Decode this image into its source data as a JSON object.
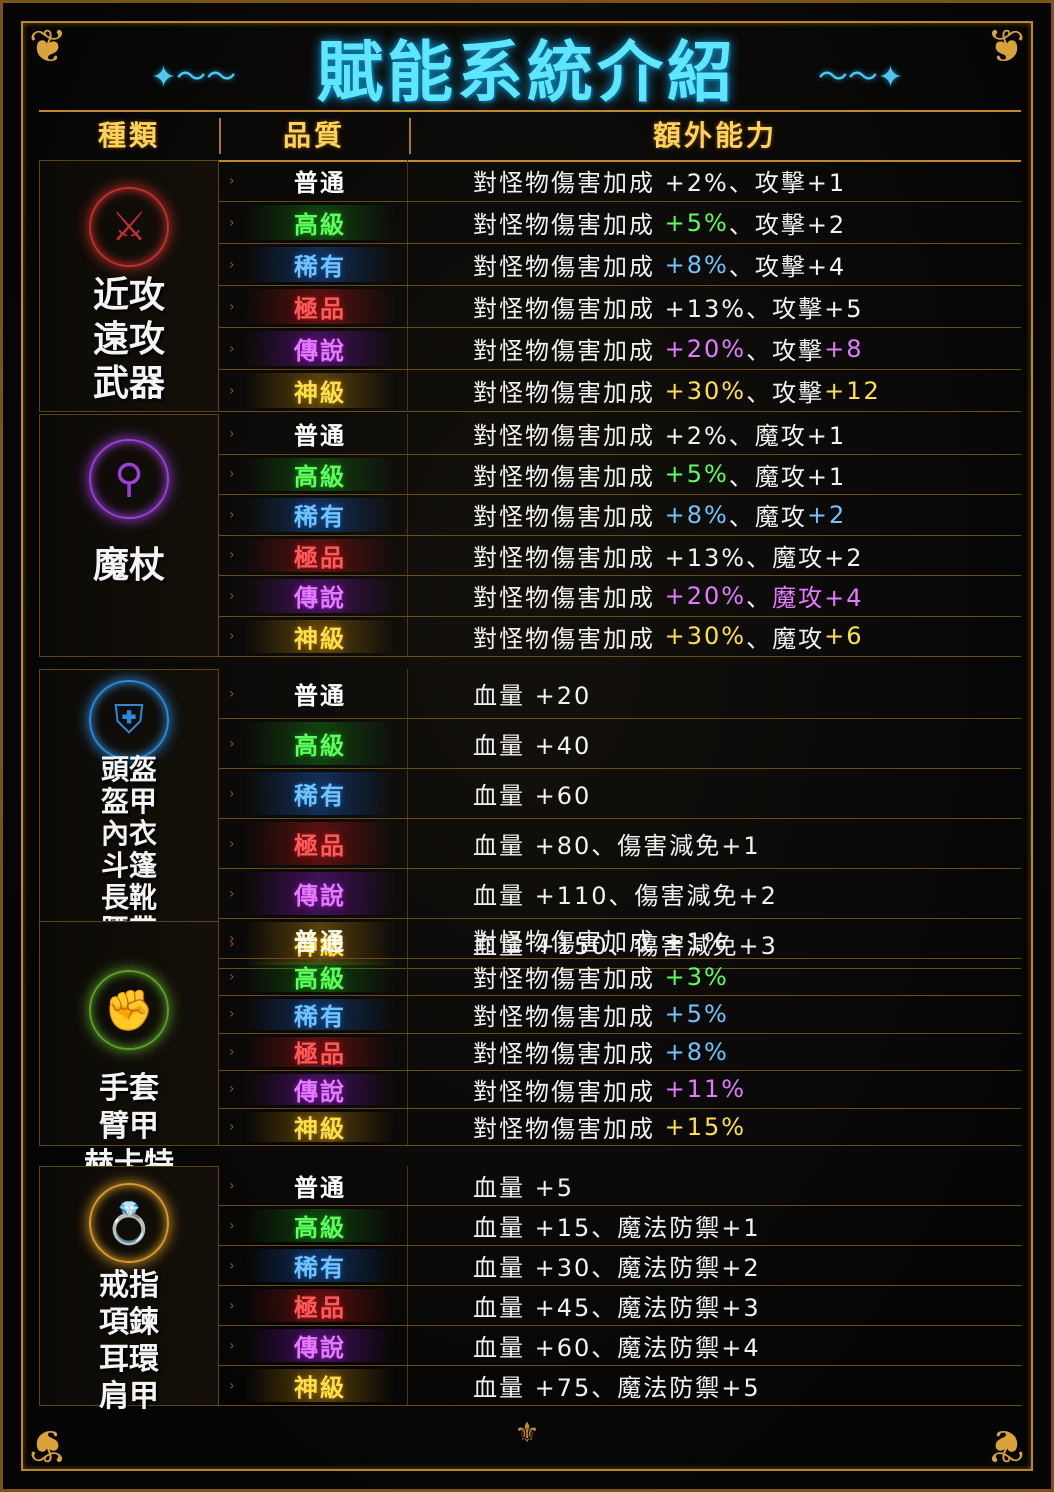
{
  "title": "賦能系統介紹",
  "headers": {
    "type": "種類",
    "quality": "品質",
    "extra": "額外能力"
  },
  "colors": {
    "common": "#ffffff",
    "high": "#5cff5c",
    "rare": "#6fc4ff",
    "epic": "#ff5a5a",
    "legend": "#e27bff",
    "god": "#ffe04a",
    "frame": "#b8862b",
    "title": "#5fe6ff"
  },
  "groups": [
    {
      "category": "近攻\n遠攻\n武器",
      "icon": "crossed-swords-icon",
      "rows": [
        {
          "quality": "普通",
          "q": "common",
          "text": [
            {
              "t": "對怪物傷害加成 +2%、攻擊+1"
            }
          ]
        },
        {
          "quality": "高級",
          "q": "high",
          "text": [
            {
              "t": "對怪物傷害加成 "
            },
            {
              "t": "+5%",
              "c": "green"
            },
            {
              "t": "、攻擊+2"
            }
          ]
        },
        {
          "quality": "稀有",
          "q": "rare",
          "text": [
            {
              "t": "對怪物傷害加成 "
            },
            {
              "t": "+8%",
              "c": "blue"
            },
            {
              "t": "、攻擊+4"
            }
          ]
        },
        {
          "quality": "極品",
          "q": "epic",
          "text": [
            {
              "t": "對怪物傷害加成 +13%、攻擊+5"
            }
          ]
        },
        {
          "quality": "傳說",
          "q": "legend",
          "text": [
            {
              "t": "對怪物傷害加成 "
            },
            {
              "t": "+20%",
              "c": "purple"
            },
            {
              "t": "、攻擊"
            },
            {
              "t": "+8",
              "c": "purple"
            }
          ]
        },
        {
          "quality": "神級",
          "q": "god",
          "text": [
            {
              "t": "對怪物傷害加成 "
            },
            {
              "t": "+30%",
              "c": "gold"
            },
            {
              "t": "、攻擊"
            },
            {
              "t": "+12",
              "c": "gold"
            }
          ]
        }
      ]
    },
    {
      "category": "魔杖",
      "icon": "magic-staff-icon",
      "rows": [
        {
          "quality": "普通",
          "q": "common",
          "text": [
            {
              "t": "對怪物傷害加成 +2%、魔攻+1"
            }
          ]
        },
        {
          "quality": "高級",
          "q": "high",
          "text": [
            {
              "t": "對怪物傷害加成 "
            },
            {
              "t": "+5%",
              "c": "green"
            },
            {
              "t": "、魔攻+1"
            }
          ]
        },
        {
          "quality": "稀有",
          "q": "rare",
          "text": [
            {
              "t": "對怪物傷害加成 "
            },
            {
              "t": "+8%",
              "c": "blue"
            },
            {
              "t": "、魔攻"
            },
            {
              "t": "+2",
              "c": "blue"
            }
          ]
        },
        {
          "quality": "極品",
          "q": "epic",
          "text": [
            {
              "t": "對怪物傷害加成 +13%、魔攻+2"
            }
          ]
        },
        {
          "quality": "傳說",
          "q": "legend",
          "text": [
            {
              "t": "對怪物傷害加成 "
            },
            {
              "t": "+20%",
              "c": "purple"
            },
            {
              "t": "、"
            },
            {
              "t": "魔攻+4",
              "c": "purple"
            }
          ]
        },
        {
          "quality": "神級",
          "q": "god",
          "text": [
            {
              "t": "對怪物傷害加成 "
            },
            {
              "t": "+30%",
              "c": "gold"
            },
            {
              "t": "、魔攻"
            },
            {
              "t": "+6",
              "c": "gold"
            }
          ]
        }
      ]
    },
    {
      "category": "頭盔\n盔甲\n內衣\n斗篷\n長靴\n腰帶\n褲子",
      "icon": "helmet-icon",
      "rows": [
        {
          "quality": "普通",
          "q": "common",
          "text": [
            {
              "t": "血量 +20"
            }
          ]
        },
        {
          "quality": "高級",
          "q": "high",
          "text": [
            {
              "t": "血量 +40"
            }
          ]
        },
        {
          "quality": "稀有",
          "q": "rare",
          "text": [
            {
              "t": "血量 +60"
            }
          ]
        },
        {
          "quality": "極品",
          "q": "epic",
          "text": [
            {
              "t": "血量 +80、傷害減免+1"
            }
          ]
        },
        {
          "quality": "傳說",
          "q": "legend",
          "text": [
            {
              "t": "血量 +110、傷害減免+2"
            }
          ]
        },
        {
          "quality": "神級",
          "q": "god",
          "text": [
            {
              "t": "血量 +150、傷害減免+3"
            }
          ]
        }
      ]
    },
    {
      "category": "手套\n臂甲\n赫卡特",
      "icon": "gauntlet-icon",
      "rows": [
        {
          "quality": "普通",
          "q": "common",
          "text": [
            {
              "t": "對怪物傷害加成 +1%"
            }
          ]
        },
        {
          "quality": "高級",
          "q": "high",
          "text": [
            {
              "t": "對怪物傷害加成 "
            },
            {
              "t": "+3%",
              "c": "green"
            }
          ]
        },
        {
          "quality": "稀有",
          "q": "rare",
          "text": [
            {
              "t": "對怪物傷害加成 "
            },
            {
              "t": "+5%",
              "c": "blue"
            }
          ]
        },
        {
          "quality": "極品",
          "q": "epic",
          "text": [
            {
              "t": "對怪物傷害加成 "
            },
            {
              "t": "+8%",
              "c": "blue"
            }
          ]
        },
        {
          "quality": "傳說",
          "q": "legend",
          "text": [
            {
              "t": "對怪物傷害加成 "
            },
            {
              "t": "+11%",
              "c": "purple"
            }
          ]
        },
        {
          "quality": "神級",
          "q": "god",
          "text": [
            {
              "t": "對怪物傷害加成 "
            },
            {
              "t": "+15%",
              "c": "gold"
            }
          ]
        }
      ]
    },
    {
      "category": "戒指\n項鍊\n耳環\n肩甲",
      "icon": "ring-icon",
      "rows": [
        {
          "quality": "普通",
          "q": "common",
          "text": [
            {
              "t": "血量 +5"
            }
          ]
        },
        {
          "quality": "高級",
          "q": "high",
          "text": [
            {
              "t": "血量 +15、魔法防禦+1"
            }
          ]
        },
        {
          "quality": "稀有",
          "q": "rare",
          "text": [
            {
              "t": "血量 +30、魔法防禦+2"
            }
          ]
        },
        {
          "quality": "極品",
          "q": "epic",
          "text": [
            {
              "t": "血量 +45、魔法防禦+3"
            }
          ]
        },
        {
          "quality": "傳說",
          "q": "legend",
          "text": [
            {
              "t": "血量 +60、魔法防禦+4"
            }
          ]
        },
        {
          "quality": "神級",
          "q": "god",
          "text": [
            {
              "t": "血量 +75、魔法防禦+5"
            }
          ]
        }
      ]
    }
  ]
}
